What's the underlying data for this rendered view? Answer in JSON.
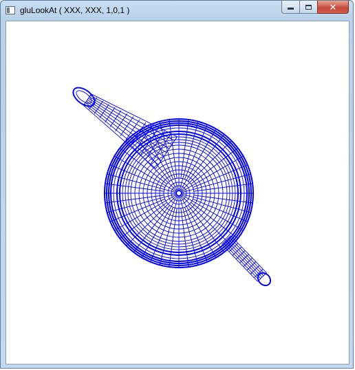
{
  "window": {
    "title": "gluLookAt ( XXX, XXX, 1,0,1 )",
    "minimize_icon": "minimize-icon",
    "maximize_icon": "maximize-icon",
    "close_icon": "close-icon"
  },
  "scene": {
    "object": "teapot-wireframe",
    "wire_color": "#0000ff",
    "background_color": "#ffffff"
  }
}
